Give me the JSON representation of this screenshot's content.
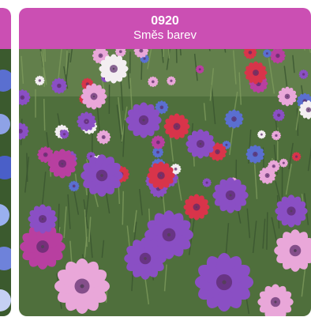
{
  "cards": [
    {
      "code": "0920",
      "name": "Směs barev",
      "image_icon": "cornflower-mix-photo",
      "colors": {
        "header": "#cb4fb3",
        "foliage": "#4f6f3c",
        "purple": "#8a4fc4",
        "magenta": "#b83fa0",
        "red": "#d8344a",
        "pink": "#e9a7d9",
        "white": "#f3eef1",
        "blue": "#5a6fd0"
      }
    }
  ]
}
